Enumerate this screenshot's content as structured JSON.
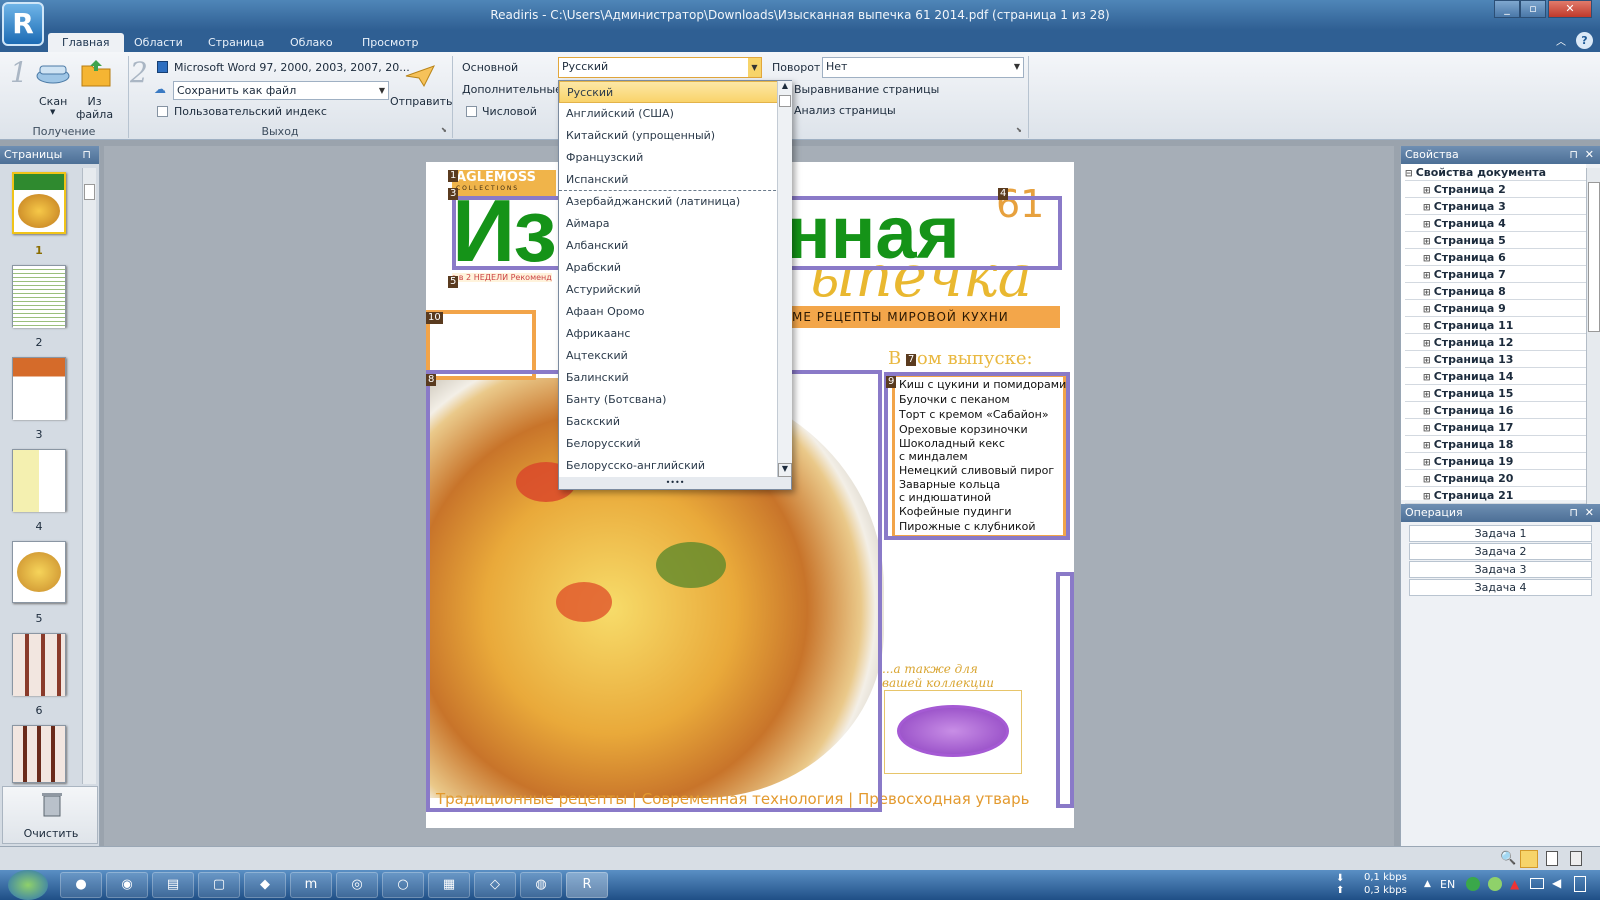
{
  "window": {
    "title": "Readiris - C:\\Users\\Администратор\\Downloads\\Изысканная выпечка 61 2014.pdf (страница 1 из 28)",
    "logo_letter": "R"
  },
  "tabs": [
    "Главная",
    "Области",
    "Страница",
    "Облако",
    "Просмотр"
  ],
  "ribbon": {
    "step1": "1",
    "step2": "2",
    "scan_label": "Скан",
    "from_file_label": "Из\nфайла",
    "acquire_group": "Получение",
    "output_format": "Microsoft Word 97, 2000, 2003, 2007, 20...",
    "save_as": "Сохранить как файл",
    "custom_index": "Пользовательский индекс",
    "send_label": "Отправить",
    "output_group": "Выход",
    "main_label": "Основной",
    "main_value": "Русский",
    "additional_label": "Дополнительные",
    "numeric_label": "Числовой",
    "rotation_label": "Поворот",
    "rotation_value": "Нет",
    "page_align": "Выравнивание страницы",
    "page_analysis": "Анализ страницы",
    "config_group": "Конфигурация"
  },
  "language_dropdown": {
    "items": [
      "Русский",
      "Английский (США)",
      "Китайский (упрощенный)",
      "Французский",
      "Испанский",
      "Азербайджанский (латиница)",
      "Аймара",
      "Албанский",
      "Арабский",
      "Астурийский",
      "Афаан Оромо",
      "Африкаанс",
      "Ацтекский",
      "Балинский",
      "Банту (Ботсвана)",
      "Баскский",
      "Белорусский",
      "Белорусско-английский"
    ],
    "selected": "Русский"
  },
  "pages_panel": {
    "title": "Страницы",
    "thumbs": [
      "1",
      "2",
      "3",
      "4",
      "5",
      "6"
    ],
    "clear_label": "Очистить"
  },
  "properties": {
    "title": "Свойства",
    "root": "Свойства документа",
    "pages": [
      "Страница 2",
      "Страница 3",
      "Страница 4",
      "Страница 5",
      "Страница 6",
      "Страница 7",
      "Страница 8",
      "Страница 9",
      "Страница 11",
      "Страница 12",
      "Страница 13",
      "Страница 14",
      "Страница 15",
      "Страница 16",
      "Страница 17",
      "Страница 18",
      "Страница 19",
      "Страница 20",
      "Страница 21"
    ]
  },
  "operations": {
    "title": "Операция",
    "tasks": [
      "Задача 1",
      "Задача 2",
      "Задача 3",
      "Задача 4"
    ]
  },
  "document": {
    "brand": "AGLEMOSS",
    "brand_sub": "C O L L E C T I O N S",
    "title_big": "Из",
    "title_big2": "нная",
    "title_script": "ыпечка",
    "issue": "61",
    "subtitle": "МЕ РЕЦЕПТЫ МИРОВОЙ КУХНИ",
    "in_issue": "В  том выпуске:",
    "contents": [
      "Киш с цукини и помидорами",
      "Булочки с пеканом",
      "Торт с кремом «Сабайон»",
      "Ореховые корзиночки",
      "Шоколадный кекс\nс миндалем",
      "Немецкий сливовый пирог",
      "Заварные кольца\nс индюшатиной",
      "Кофейные пудинги",
      "Пирожные с клубникой"
    ],
    "also": "...а также для\nвашей коллекции",
    "footer": "Традиционные рецепты | Современная технология | Превосходная утварь",
    "tiny": "з в 2 НЕДЕЛИ   Рекоменд"
  },
  "taskbar": {
    "net_down": "0,1 kbps",
    "net_up": "0,3 kbps",
    "lang": "EN"
  }
}
